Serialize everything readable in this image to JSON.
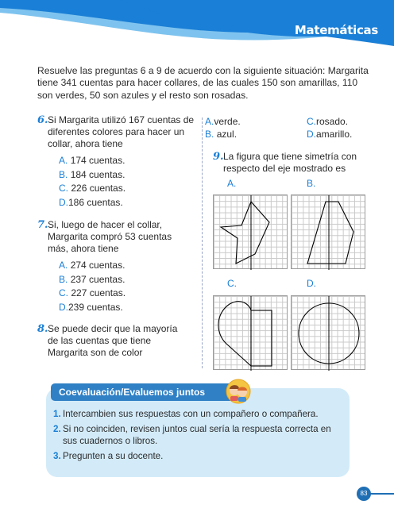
{
  "header": {
    "subject": "Matemáticas",
    "colors": {
      "primary": "#1a7fd6",
      "light": "#7ec3ef"
    }
  },
  "intro": "Resuelve las preguntas 6 a 9 de acuerdo con la siguiente situación: Margarita tiene 341 cuentas para hacer collares, de las cuales 150 son amarillas, 110 son verdes, 50 son azules y el resto son rosadas.",
  "q6": {
    "num": "6.",
    "text": "Si Margarita utilizó 167 cuentas de diferentes colores para hacer un collar, ahora tiene",
    "options": [
      {
        "letter": "A.",
        "text": "174 cuentas."
      },
      {
        "letter": "B.",
        "text": "184 cuentas."
      },
      {
        "letter": "C.",
        "text": "226 cuentas."
      },
      {
        "letter": "D.",
        "text": "186 cuentas."
      }
    ]
  },
  "q7": {
    "num": "7.",
    "text": "Si, luego de hacer el collar, Margarita compró 53 cuentas más, ahora tiene",
    "options": [
      {
        "letter": "A.",
        "text": "274 cuentas."
      },
      {
        "letter": "B.",
        "text": "237 cuentas."
      },
      {
        "letter": "C.",
        "text": "227 cuentas."
      },
      {
        "letter": "D.",
        "text": "239 cuentas."
      }
    ]
  },
  "q8": {
    "num": "8.",
    "text": "Se puede decir que la mayoría de las cuentas que tiene Margarita son de color",
    "options": [
      {
        "letter": "A.",
        "text": "verde."
      },
      {
        "letter": "C.",
        "text": "rosado."
      },
      {
        "letter": "B.",
        "text": "azul."
      },
      {
        "letter": "D.",
        "text": "amarillo."
      }
    ]
  },
  "q9": {
    "num": "9.",
    "text": "La figura que tiene simetría con respecto del eje mostrado es",
    "figures": [
      {
        "letter": "A.",
        "shape": "star"
      },
      {
        "letter": "B.",
        "shape": "trapezoid"
      },
      {
        "letter": "C.",
        "shape": "heart"
      },
      {
        "letter": "D.",
        "shape": "circle"
      }
    ]
  },
  "coeval": {
    "title": "Coevaluación/Evaluemos juntos",
    "icon": "kids-icon",
    "items": [
      {
        "num": "1.",
        "text": "Intercambien sus respuestas con un compañero o compañera."
      },
      {
        "num": "2.",
        "text": "Si no coinciden, revisen juntos cual sería la respuesta correcta en sus cuadernos o libros."
      },
      {
        "num": "3.",
        "text": "Pregunten a su docente."
      }
    ]
  },
  "page_number": "83"
}
